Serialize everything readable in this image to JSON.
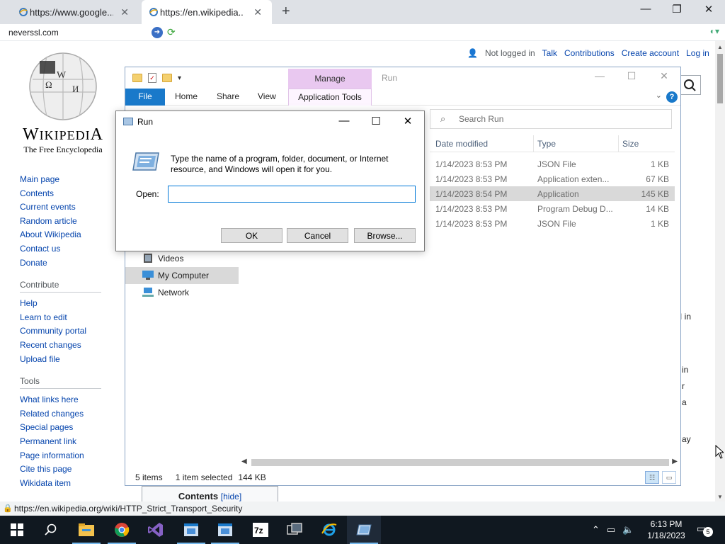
{
  "browser": {
    "tabs": [
      {
        "title": "https://www.google...",
        "active": false
      },
      {
        "title": "https://en.wikipedia...",
        "active": true
      }
    ],
    "url": "neverssl.com",
    "status_url": "https://en.wikipedia.org/wiki/HTTP_Strict_Transport_Security"
  },
  "wiki": {
    "user_links": {
      "not_logged_in": "Not logged in",
      "talk": "Talk",
      "contributions": "Contributions",
      "create_account": "Create account",
      "log_in": "Log in"
    },
    "wordmark": "Wikipedia",
    "tagline": "The Free Encyclopedia",
    "nav_main": [
      "Main page",
      "Contents",
      "Current events",
      "Random article",
      "About Wikipedia",
      "Contact us",
      "Donate"
    ],
    "contribute_heading": "Contribute",
    "nav_contribute": [
      "Help",
      "Learn to edit",
      "Community portal",
      "Recent changes",
      "Upload file"
    ],
    "tools_heading": "Tools",
    "nav_tools": [
      "What links here",
      "Related changes",
      "Special pages",
      "Permanent link",
      "Page information",
      "Cite this page",
      "Wikidata item"
    ],
    "fragments": [
      "I in",
      "in",
      "r",
      "a",
      "ay"
    ],
    "contents_title": "Contents",
    "contents_hide": "[hide]"
  },
  "explorer": {
    "manage_tab": "Manage",
    "title": "Run",
    "ribbon_tabs": [
      "File",
      "Home",
      "Share",
      "View",
      "Application Tools"
    ],
    "search_placeholder": "Search Run",
    "columns": {
      "date": "Date modified",
      "type": "Type",
      "size": "Size"
    },
    "rows": [
      {
        "date": "1/14/2023 8:53 PM",
        "type": "JSON File",
        "size": "1 KB",
        "selected": false
      },
      {
        "date": "1/14/2023 8:53 PM",
        "type": "Application exten...",
        "size": "67 KB",
        "selected": false
      },
      {
        "date": "1/14/2023 8:54 PM",
        "type": "Application",
        "size": "145 KB",
        "selected": true
      },
      {
        "date": "1/14/2023 8:53 PM",
        "type": "Program Debug D...",
        "size": "14 KB",
        "selected": false
      },
      {
        "date": "1/14/2023 8:53 PM",
        "type": "JSON File",
        "size": "1 KB",
        "selected": false
      }
    ],
    "sidebar": [
      {
        "label": "Videos",
        "icon": "video-folder-icon",
        "selected": false
      },
      {
        "label": "My Computer",
        "icon": "computer-icon",
        "selected": true
      },
      {
        "label": "Network",
        "icon": "network-icon",
        "selected": false
      }
    ],
    "status": {
      "items": "5 items",
      "selected": "1 item selected",
      "size": "144 KB"
    }
  },
  "run_dialog": {
    "title": "Run",
    "description": "Type the name of a program, folder, document, or Internet resource, and Windows will open it for you.",
    "open_label": "Open:",
    "input_value": "",
    "ok_label": "OK",
    "cancel_label": "Cancel",
    "browse_label": "Browse..."
  },
  "taskbar": {
    "apps": [
      "start-button",
      "search-button",
      "file-explorer",
      "chrome",
      "visual-studio",
      "app-window-1",
      "app-window-2",
      "7zip",
      "task-view-app",
      "internet-explorer",
      "run-app"
    ],
    "time": "6:13 PM",
    "date": "1/18/2023",
    "notification_count": "5"
  },
  "colors": {
    "ribbon_file": "#1979ca",
    "manage_tab": "#e9c8f0",
    "link": "#0645ad",
    "taskbar": "#101820"
  }
}
